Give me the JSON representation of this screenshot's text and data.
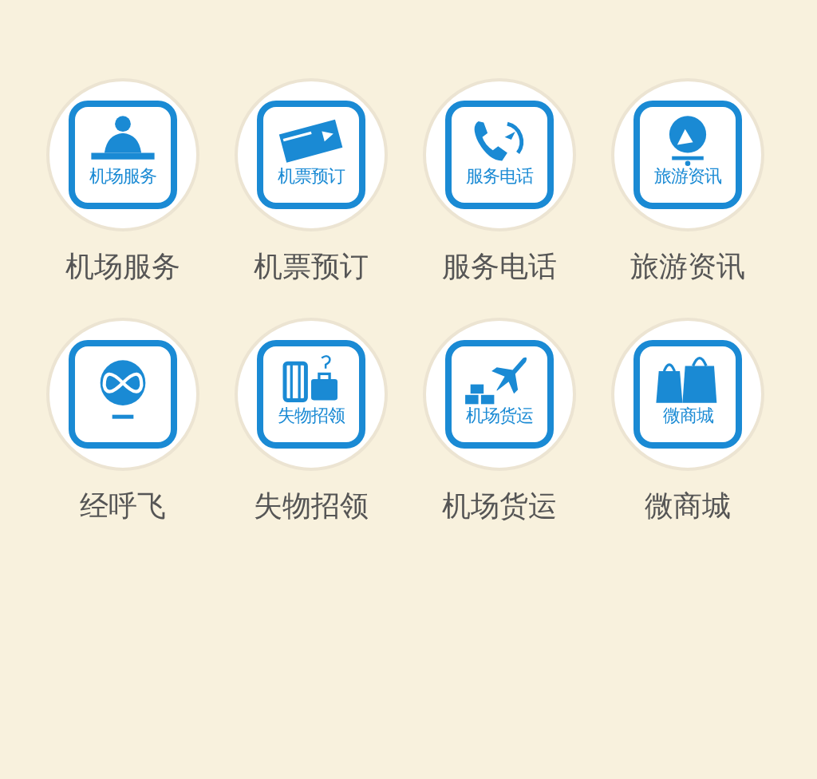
{
  "items": [
    {
      "kind": "agent",
      "icon_text": "机场服务",
      "label": "机场服务"
    },
    {
      "kind": "ticket",
      "icon_text": "机票预订",
      "label": "机票预订"
    },
    {
      "kind": "phone",
      "icon_text": "服务电话",
      "label": "服务电话"
    },
    {
      "kind": "travel",
      "icon_text": "旅游资讯",
      "label": "旅游资讯"
    },
    {
      "kind": "app",
      "label": "经呼飞"
    },
    {
      "kind": "luggage",
      "icon_text": "失物招领",
      "label": "失物招领"
    },
    {
      "kind": "cargo",
      "icon_text": "机场货运",
      "label": "机场货运"
    },
    {
      "kind": "shop",
      "icon_text": "微商城",
      "label": "微商城"
    }
  ]
}
